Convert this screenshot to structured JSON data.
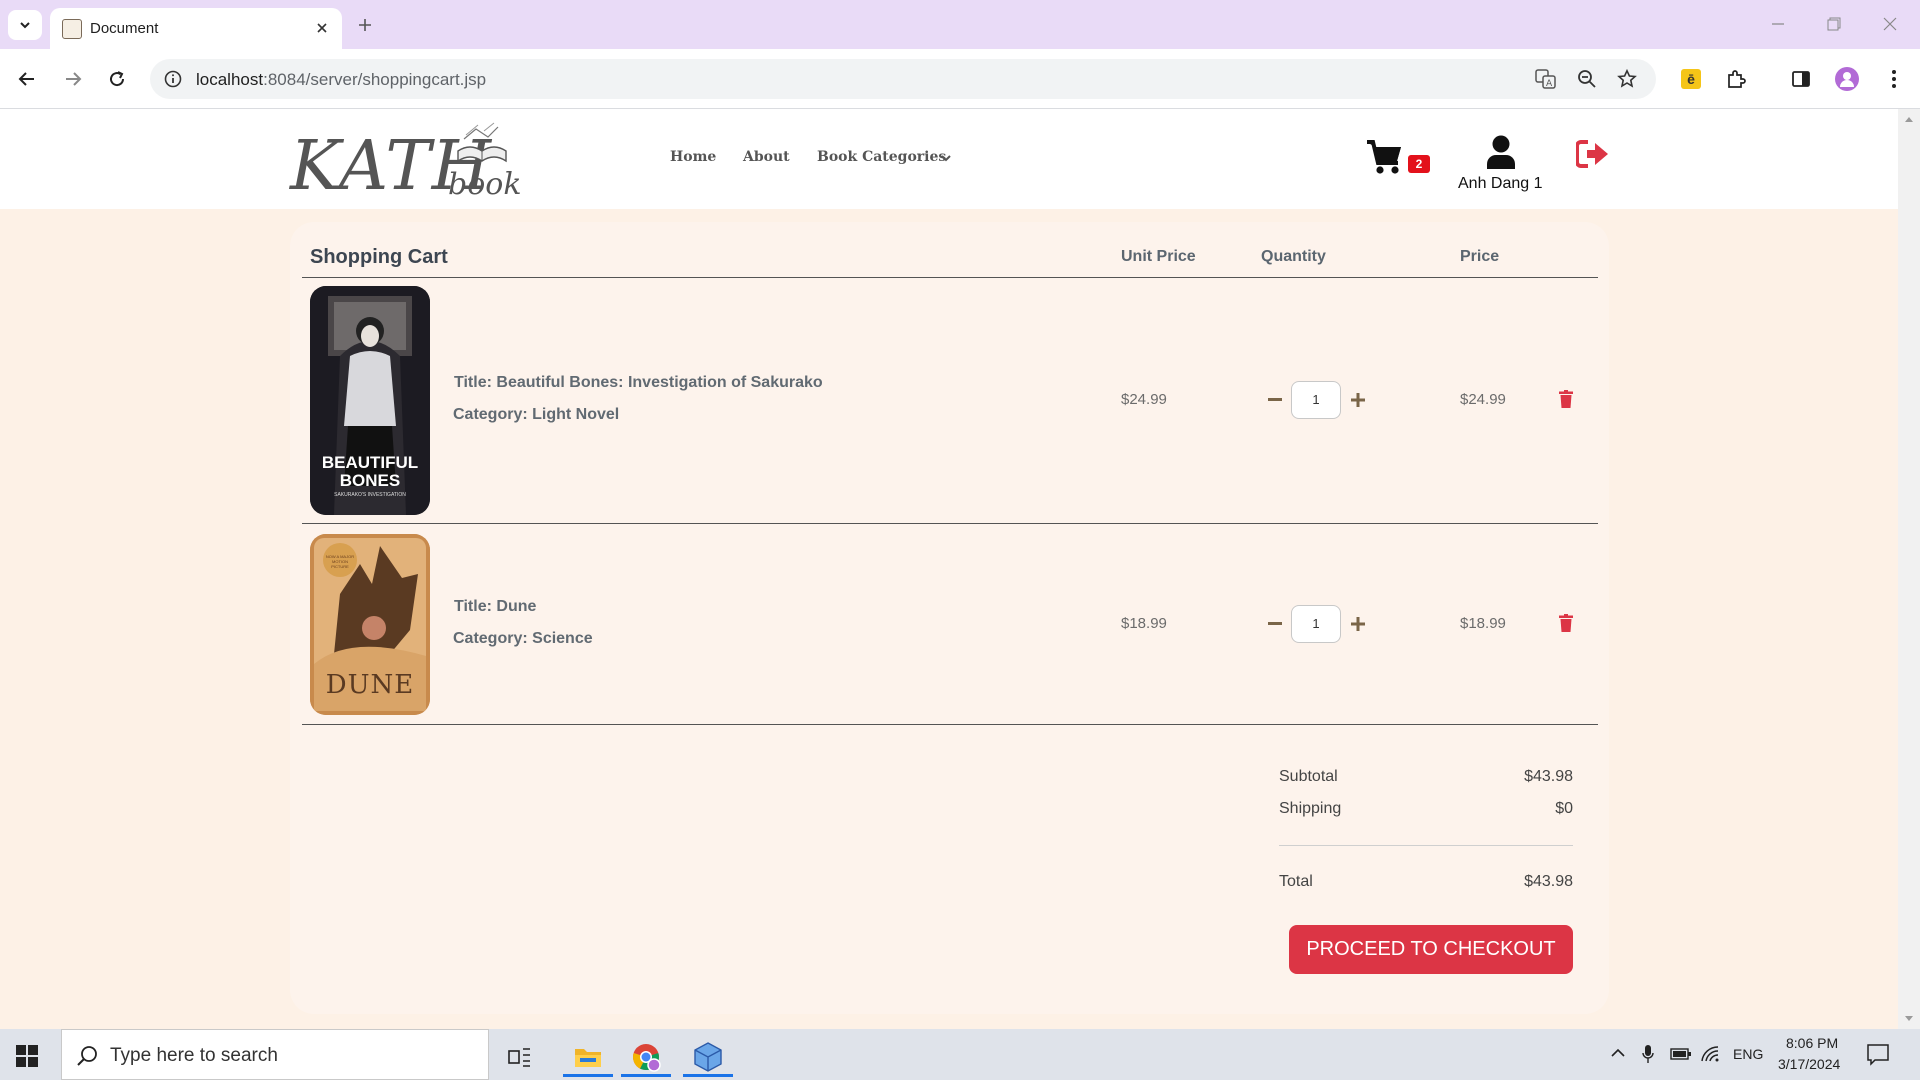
{
  "browser": {
    "tab_title": "Document",
    "url_host": "localhost",
    "url_rest": ":8084/server/shoppingcart.jsp"
  },
  "site": {
    "logo_main": "KATH",
    "logo_sub": "book",
    "nav": [
      {
        "label": "Home"
      },
      {
        "label": "About"
      },
      {
        "label": "Book Categories"
      }
    ],
    "cart_count": "2",
    "username": "Anh Dang 1"
  },
  "cart": {
    "heading": "Shopping Cart",
    "columns": {
      "unit_price": "Unit Price",
      "quantity": "Quantity",
      "price": "Price"
    },
    "items": [
      {
        "title_label": "Title:",
        "title": "Beautiful Bones: Investigation of Sakurako",
        "category_label": "Category:",
        "category": "Light Novel",
        "unit_price": "$24.99",
        "quantity": "1",
        "price": "$24.99",
        "cover_text": "BEAUTIFUL BONES",
        "cover_subtext": "SAKURAKO'S INVESTIGATION"
      },
      {
        "title_label": "Title:",
        "title": "Dune",
        "category_label": "Category:",
        "category": "Science",
        "unit_price": "$18.99",
        "quantity": "1",
        "price": "$18.99",
        "cover_text": "DUNE",
        "cover_subtext": "NOW A MAJOR MOTION PICTURE"
      }
    ],
    "summary": {
      "subtotal_label": "Subtotal",
      "subtotal": "$43.98",
      "shipping_label": "Shipping",
      "shipping": "$0",
      "total_label": "Total",
      "total": "$43.98"
    },
    "checkout_label": "PROCEED TO CHECKOUT"
  },
  "taskbar": {
    "search_placeholder": "Type here to search",
    "language": "ENG",
    "time": "8:06 PM",
    "date": "3/17/2024"
  },
  "colors": {
    "accent_red": "#dc3545",
    "page_bg": "#fdf1e6",
    "card_bg": "#fdf3ec",
    "tabstrip": "#e9dbf7"
  }
}
